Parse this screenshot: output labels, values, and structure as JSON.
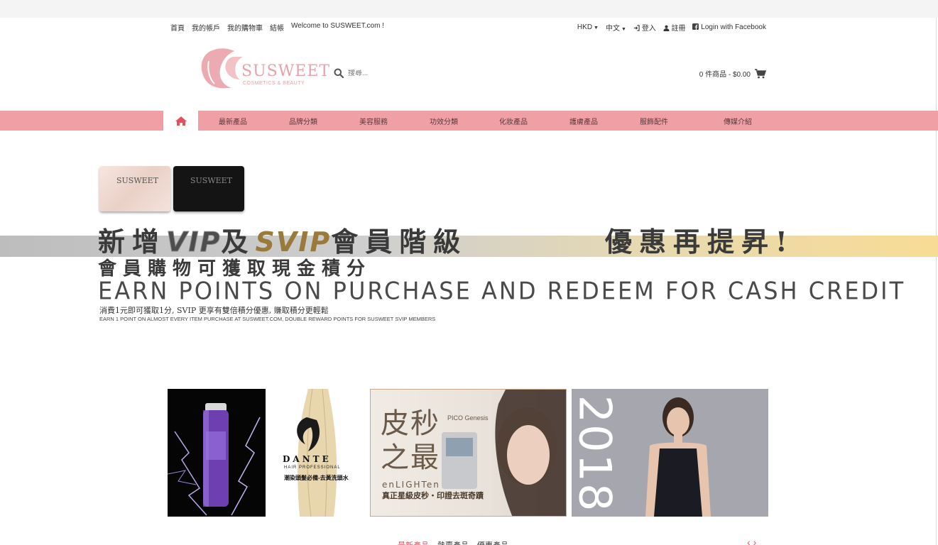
{
  "utility_bar": {
    "left_links": [
      "首頁",
      "我的帳戶",
      "我的購物車",
      "結帳",
      "Welcome to SUSWEET.com !"
    ],
    "currency": "HKD",
    "language": "中文",
    "login_label": "登入",
    "register_label": "註冊",
    "facebook_label": "Login with Facebook"
  },
  "header": {
    "logo_text": "SUSWEET",
    "logo_subtitle": "COSMETICS & BEAUTY",
    "search_placeholder": "搜尋...",
    "cart_summary": "0 件商品 - $0.00"
  },
  "nav": {
    "items": [
      "最新產品",
      "品牌分類",
      "美容服務",
      "功效分類",
      "化妝產品",
      "護膚產品",
      "服飾配件",
      "傳媒介紹"
    ]
  },
  "banner": {
    "card_logo": "SUSWEET",
    "headline_prefix": "新增",
    "headline_vip": "VIP",
    "headline_mid": "及",
    "headline_svip": "SVIP",
    "headline_suffix": "會員階級",
    "headline_right": "優惠再提昇!",
    "subtitle_cn": "會員購物可獲取現金積分",
    "subtitle_en": "EARN POINTS ON PURCHASE AND REDEEM FOR CASH CREDIT",
    "detail_cn": "消費1元即可獲取1分, SVIP 更享有雙倍積分優惠, 賺取積分更輕鬆",
    "detail_en": "EARN 1 POINT ON ALMOST EVERY ITEM PURCHASE AT SUSWEET.COM, DOUBLE REWARD POINTS FOR SUSWEET SVIP MEMBERS"
  },
  "promos": {
    "dante_brand": "DANTE",
    "dante_sub": "HAIR PROFESSIONAL",
    "dante_cn": "潮染頭髮必備-去黃洗頭水",
    "pico_chars": [
      "皮",
      "秒",
      "之",
      "最"
    ],
    "pico_brand": "PICO Genesis",
    "pico_en": "enLIGHTen",
    "pico_cn": "真正星級皮秒・印證去斑奇蹟",
    "year": "2018"
  },
  "product_tabs": {
    "items": [
      "最新產品",
      "熱賣產品",
      "優惠產品"
    ],
    "active_index": 0
  },
  "colors": {
    "nav_bg": "#f0a0a4",
    "accent": "#e0535c",
    "logo_pink": "#e6a2a8"
  }
}
